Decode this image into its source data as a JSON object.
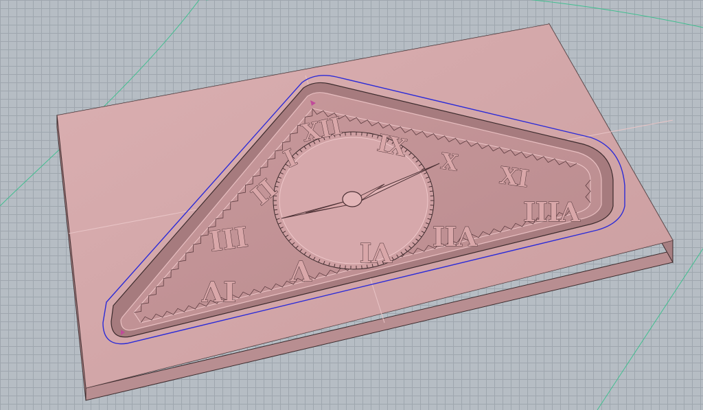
{
  "viewport": {
    "name": "3D modeling viewport",
    "background_color": "#b6bdc4",
    "grid_color": "#9ea6ae"
  },
  "model": {
    "description_color": "#d9a7a9",
    "edge_color": "#3b2a2c",
    "toolpath_color": "#2a2ad8",
    "axis_color": "#3fbf8f"
  },
  "numerals": {
    "I": "I",
    "II": "II",
    "III": "III",
    "IV": "IV",
    "V": "V",
    "VI": "VI",
    "VII": "VII",
    "VIII": "VIII",
    "IX": "IX",
    "X": "X",
    "XI": "XI",
    "XII": "XII"
  }
}
